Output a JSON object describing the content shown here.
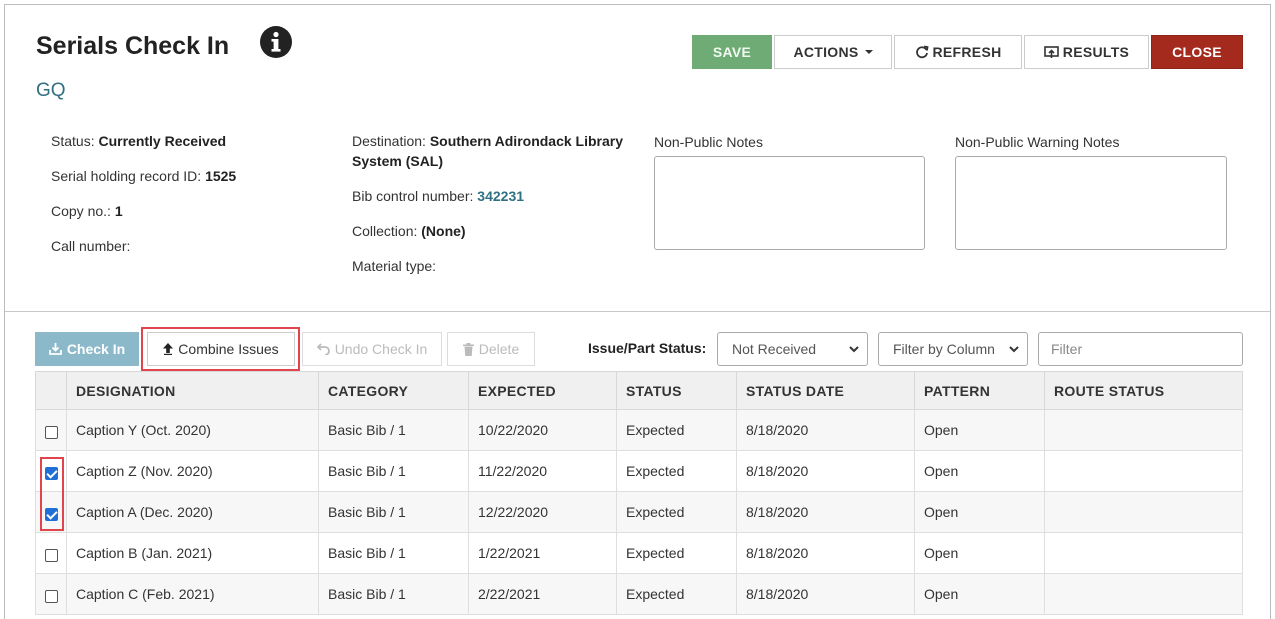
{
  "header": {
    "title": "Serials Check In",
    "subtitle": "GQ"
  },
  "toolbar": {
    "save": "SAVE",
    "actions": "ACTIONS",
    "refresh": "REFRESH",
    "results": "RESULTS",
    "close": "CLOSE"
  },
  "details": {
    "status_label": "Status:",
    "status_value": "Currently Received",
    "holding_label": "Serial holding record ID:",
    "holding_value": "1525",
    "copy_label": "Copy no.:",
    "copy_value": "1",
    "call_label": "Call number:",
    "destination_label": "Destination:",
    "destination_value_1": "Southern Adirondack Library",
    "destination_value_2": "System (SAL)",
    "bib_label": "Bib control number:",
    "bib_value": "342231",
    "collection_label": "Collection:",
    "collection_value": "(None)",
    "material_label": "Material type:"
  },
  "notes": {
    "nonpublic_label": "Non-Public Notes",
    "warning_label": "Non-Public Warning Notes"
  },
  "issues_toolbar": {
    "check_in": "Check In",
    "combine": "Combine Issues",
    "undo": "Undo Check In",
    "delete": "Delete",
    "status_label": "Issue/Part Status:",
    "status_value": "Not Received",
    "filter_column": "Filter by Column",
    "filter_placeholder": "Filter"
  },
  "table": {
    "columns": [
      "DESIGNATION",
      "CATEGORY",
      "EXPECTED",
      "STATUS",
      "STATUS DATE",
      "PATTERN",
      "ROUTE STATUS"
    ],
    "rows": [
      {
        "checked": false,
        "designation": "Caption Y (Oct. 2020)",
        "category": "Basic Bib / 1",
        "expected": "10/22/2020",
        "status": "Expected",
        "status_date": "8/18/2020",
        "pattern": "Open",
        "route": ""
      },
      {
        "checked": true,
        "designation": "Caption Z (Nov. 2020)",
        "category": "Basic Bib / 1",
        "expected": "11/22/2020",
        "status": "Expected",
        "status_date": "8/18/2020",
        "pattern": "Open",
        "route": ""
      },
      {
        "checked": true,
        "designation": "Caption A (Dec. 2020)",
        "category": "Basic Bib / 1",
        "expected": "12/22/2020",
        "status": "Expected",
        "status_date": "8/18/2020",
        "pattern": "Open",
        "route": ""
      },
      {
        "checked": false,
        "designation": "Caption B (Jan. 2021)",
        "category": "Basic Bib / 1",
        "expected": "1/22/2021",
        "status": "Expected",
        "status_date": "8/18/2020",
        "pattern": "Open",
        "route": ""
      },
      {
        "checked": false,
        "designation": "Caption C (Feb. 2021)",
        "category": "Basic Bib / 1",
        "expected": "2/22/2021",
        "status": "Expected",
        "status_date": "8/18/2020",
        "pattern": "Open",
        "route": ""
      }
    ]
  },
  "colors": {
    "save": "#6fac75",
    "close": "#a52a1e",
    "check_in": "#8bb9c9",
    "link": "#2f7083",
    "highlight": "#e0454e"
  }
}
